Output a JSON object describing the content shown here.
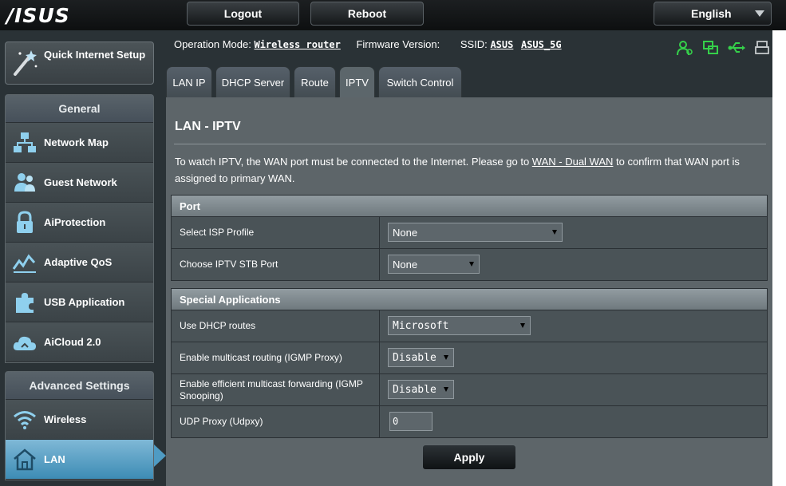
{
  "header": {
    "logo": "/ISUS",
    "logout_label": "Logout",
    "reboot_label": "Reboot",
    "language": "English"
  },
  "sidebar": {
    "quick_setup_label": "Quick Internet Setup",
    "general_heading": "General",
    "general_items": [
      {
        "label": "Network Map",
        "icon": "network-map-icon"
      },
      {
        "label": "Guest Network",
        "icon": "guest-network-icon"
      },
      {
        "label": "AiProtection",
        "icon": "lock-icon"
      },
      {
        "label": "Adaptive QoS",
        "icon": "qos-icon"
      },
      {
        "label": "USB Application",
        "icon": "puzzle-icon"
      },
      {
        "label": "AiCloud 2.0",
        "icon": "cloud-icon"
      }
    ],
    "advanced_heading": "Advanced Settings",
    "advanced_items": [
      {
        "label": "Wireless",
        "icon": "wifi-icon"
      },
      {
        "label": "LAN",
        "icon": "home-icon",
        "active": true
      }
    ]
  },
  "status": {
    "operation_mode_label": "Operation Mode:",
    "operation_mode_value": "Wireless router",
    "firmware_label": "Firmware Version:",
    "ssid_label": "SSID:",
    "ssid_1": "ASUS",
    "ssid_2": "ASUS_5G",
    "icons": [
      "clients-icon",
      "network-icon",
      "usb-icon",
      "printer-icon"
    ]
  },
  "tabs": [
    {
      "label": "LAN IP"
    },
    {
      "label": "DHCP Server"
    },
    {
      "label": "Route"
    },
    {
      "label": "IPTV",
      "active": true
    },
    {
      "label": "Switch Control"
    }
  ],
  "page": {
    "title": "LAN - IPTV",
    "desc_before": "To watch IPTV, the WAN port must be connected to the Internet. Please go to ",
    "desc_link": "WAN - Dual WAN",
    "desc_after": " to confirm that WAN port is assigned to primary WAN.",
    "port_section": {
      "heading": "Port",
      "isp_profile_label": "Select ISP Profile",
      "isp_profile_value": "None",
      "stb_port_label": "Choose IPTV STB Port",
      "stb_port_value": "None"
    },
    "special_section": {
      "heading": "Special Applications",
      "dhcp_routes_label": "Use DHCP routes",
      "dhcp_routes_value": "Microsoft",
      "igmp_proxy_label": "Enable multicast routing (IGMP Proxy)",
      "igmp_proxy_value": "Disable",
      "igmp_snooping_label": "Enable efficient multicast forwarding (IGMP Snooping)",
      "igmp_snooping_value": "Disable",
      "udpxy_label": "UDP Proxy (Udpxy)",
      "udpxy_value": "0"
    },
    "apply_label": "Apply"
  }
}
